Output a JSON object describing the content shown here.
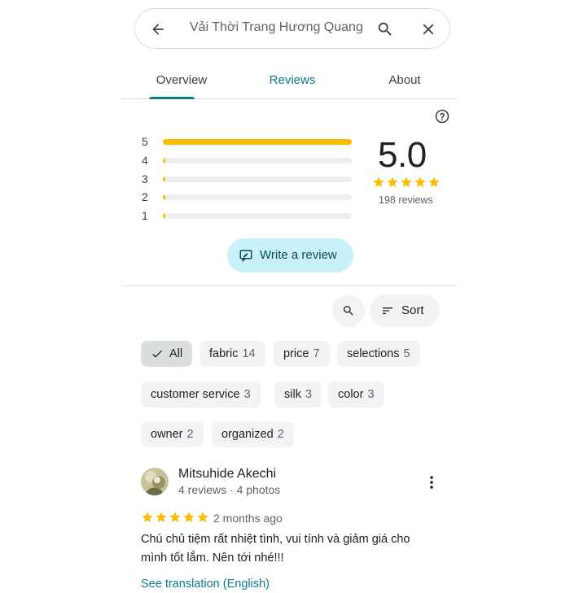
{
  "search": {
    "query": "Vải Thời Trang Hương Quang"
  },
  "tabs": [
    {
      "label": "Overview"
    },
    {
      "label": "Reviews",
      "active": true
    },
    {
      "label": "About"
    }
  ],
  "rating": {
    "score": "5.0",
    "review_count": "198 reviews",
    "stars": 5,
    "breakdown": [
      {
        "star": "5",
        "fraction": 1.0
      },
      {
        "star": "4",
        "fraction": 0.01
      },
      {
        "star": "3",
        "fraction": 0.01
      },
      {
        "star": "2",
        "fraction": 0.01
      },
      {
        "star": "1",
        "fraction": 0.01
      }
    ]
  },
  "write_review": {
    "label": "Write a review"
  },
  "sort": {
    "label": "Sort"
  },
  "chips": [
    {
      "label": "All",
      "count": ""
    },
    {
      "label": "fabric",
      "count": "14"
    },
    {
      "label": "price",
      "count": "7"
    },
    {
      "label": "selections",
      "count": "5"
    },
    {
      "label": "customer service",
      "count": "3"
    },
    {
      "label": "silk",
      "count": "3"
    },
    {
      "label": "color",
      "count": "3"
    },
    {
      "label": "owner",
      "count": "2"
    },
    {
      "label": "organized",
      "count": "2"
    }
  ],
  "review": {
    "name": "Mitsuhide Akechi",
    "meta": "4 reviews · 4 photos",
    "stars": 5,
    "date": "2 months ago",
    "text": "Chú chủ tiệm rất nhiệt tình, vui tính và giảm giá cho mình tốt lắm. Nên tới nhé!!!",
    "translation_link": "See translation (English)"
  },
  "colors": {
    "accent": "#0b7a8a",
    "star": "#fbbc04",
    "chip_bg": "#f1f3f4",
    "write_btn_bg": "#c8f1fa"
  }
}
